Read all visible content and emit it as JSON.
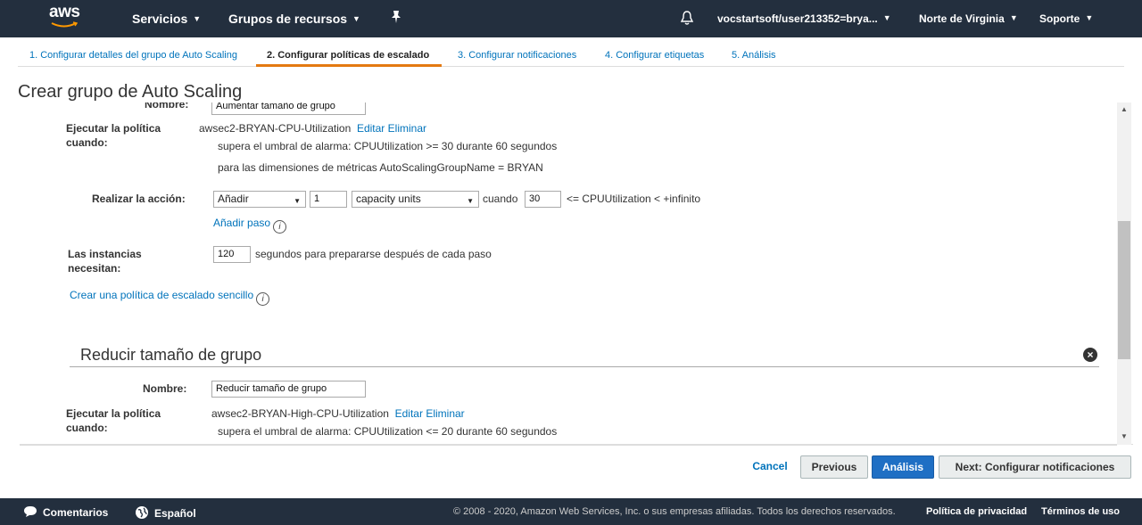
{
  "nav": {
    "logo": "aws",
    "services": "Servicios",
    "resource_groups": "Grupos de recursos",
    "pin_icon": "pin-icon",
    "bell_icon": "bell-icon",
    "account": "vocstartsoft/user213352=brya...",
    "region": "Norte de Virginia",
    "support": "Soporte"
  },
  "tabs": [
    {
      "label": "1. Configurar detalles del grupo de Auto Scaling"
    },
    {
      "label": "2. Configurar políticas de escalado"
    },
    {
      "label": "3. Configurar notificaciones"
    },
    {
      "label": "4. Configurar etiquetas"
    },
    {
      "label": "5. Análisis"
    }
  ],
  "page_title": "Crear grupo de Auto Scaling",
  "policy_increase": {
    "name_label": "Nombre:",
    "name_value": "Aumentar tamaño de grupo",
    "execute_label": "Ejecutar la política cuando:",
    "alarm_name": "awsec2-BRYAN-CPU-Utilization",
    "edit": "Editar",
    "delete": "Eliminar",
    "alarm_line1": "supera el umbral de alarma: CPUUtilization >= 30 durante 60 segundos",
    "alarm_line2": "para las dimensiones de métricas AutoScalingGroupName = BRYAN",
    "action_label": "Realizar la acción:",
    "action_select": "Añadir",
    "action_qty": "1",
    "unit_select": "capacity units",
    "when": "cuando",
    "threshold": "30",
    "range_text": "<= CPUUtilization < +infinito",
    "add_step": "Añadir paso",
    "instances_label": "Las instancias necesitan:",
    "warmup": "120",
    "warmup_text": "segundos para prepararse después de cada paso",
    "simple_policy_link": "Crear una política de escalado sencillo"
  },
  "policy_decrease": {
    "title": "Reducir tamaño de grupo",
    "name_label": "Nombre:",
    "name_value": "Reducir tamaño de grupo",
    "execute_label": "Ejecutar la política cuando:",
    "alarm_name": "awsec2-BRYAN-High-CPU-Utilization",
    "edit": "Editar",
    "delete": "Eliminar",
    "alarm_line1": "supera el umbral de alarma: CPUUtilization <= 20 durante 60 segundos"
  },
  "buttons": {
    "cancel": "Cancel",
    "previous": "Previous",
    "analysis": "Análisis",
    "next": "Next: Configurar notificaciones"
  },
  "footer": {
    "feedback": "Comentarios",
    "language": "Español",
    "copyright": "© 2008 - 2020, Amazon Web Services, Inc. o sus empresas afiliadas. Todos los derechos reservados.",
    "privacy": "Política de privacidad",
    "terms": "Términos de uso"
  },
  "colors": {
    "nav_bg": "#232f3e",
    "link": "#0073bb",
    "active_tab": "#e47911",
    "primary_button": "#1f6fc4"
  }
}
